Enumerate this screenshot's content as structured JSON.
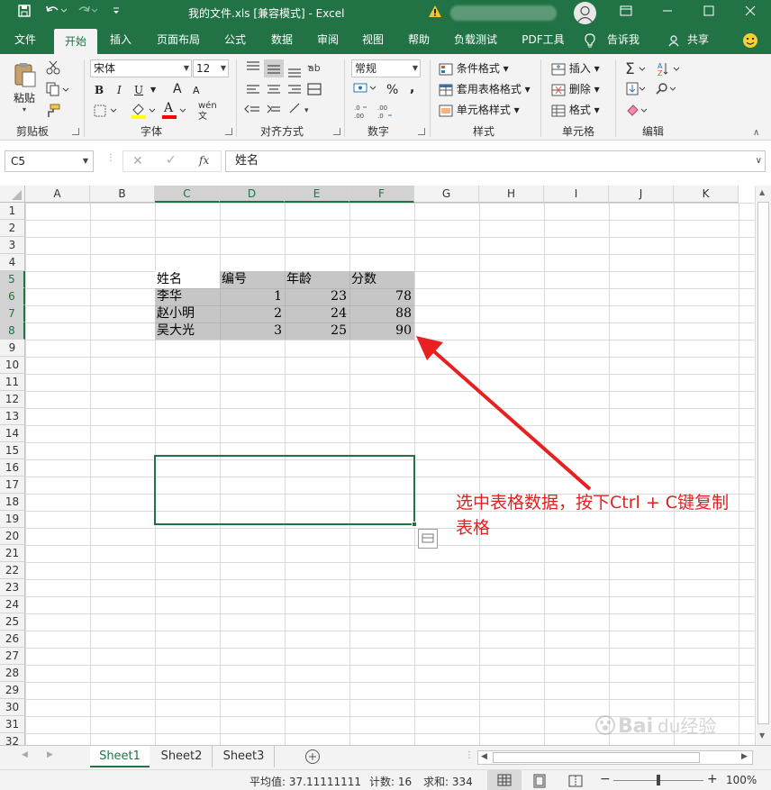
{
  "title_bar": {
    "doc_title": "我的文件.xls  [兼容模式]  -  Excel",
    "account_name": "",
    "save_icon": "save-icon",
    "undo_icon": "undo-icon",
    "redo_icon": "redo-icon",
    "warning_icon": "warning-icon",
    "accent": "#217346"
  },
  "menu_tabs": [
    "文件",
    "开始",
    "插入",
    "页面布局",
    "公式",
    "数据",
    "审阅",
    "视图",
    "帮助",
    "负载测试",
    "PDF工具"
  ],
  "menu_extra": {
    "tell_me": "告诉我",
    "share": "共享"
  },
  "ribbon": {
    "clipboard": {
      "paste": "粘贴",
      "label": "剪贴板"
    },
    "font": {
      "name": "宋体",
      "size": "12",
      "bold": "B",
      "italic": "I",
      "underline": "U",
      "grow": "A",
      "shrink": "A",
      "font_color_letter": "A",
      "phonetic": "wén",
      "label": "字体"
    },
    "alignment": {
      "label": "对齐方式"
    },
    "number": {
      "format": "常规",
      "percent": "%",
      "comma": ",",
      "label": "数字"
    },
    "styles": {
      "conditional": "条件格式",
      "table": "套用表格格式",
      "cell": "单元格样式",
      "label": "样式"
    },
    "cells": {
      "insert": "插入",
      "delete": "删除",
      "format": "格式",
      "label": "单元格"
    },
    "editing": {
      "label": "编辑"
    }
  },
  "formula_bar": {
    "name_box": "C5",
    "fx": "fx",
    "content": "姓名"
  },
  "columns": [
    "A",
    "B",
    "C",
    "D",
    "E",
    "F",
    "G",
    "H",
    "I",
    "J",
    "K"
  ],
  "selected_columns": [
    "C",
    "D",
    "E",
    "F"
  ],
  "rows": [
    "1",
    "2",
    "3",
    "4",
    "5",
    "6",
    "7",
    "8",
    "9",
    "10",
    "11",
    "12",
    "13",
    "14",
    "15",
    "16",
    "17",
    "18",
    "19",
    "20",
    "21",
    "22",
    "23",
    "24",
    "25",
    "26",
    "27",
    "28",
    "29",
    "30",
    "31",
    "32"
  ],
  "selected_rows": [
    "5",
    "6",
    "7",
    "8"
  ],
  "table": {
    "headers": [
      "姓名",
      "编号",
      "年龄",
      "分数"
    ],
    "rows": [
      [
        "李华",
        "1",
        "23",
        "78"
      ],
      [
        "赵小明",
        "2",
        "24",
        "88"
      ],
      [
        "吴大光",
        "3",
        "25",
        "90"
      ]
    ]
  },
  "annotation": "选中表格数据，按下Ctrl + C键复制表格",
  "sheets": [
    "Sheet1",
    "Sheet2",
    "Sheet3"
  ],
  "status": {
    "average": "平均值: 37.11111111",
    "count": "计数: 16",
    "sum": "求和: 334",
    "zoom": "100%"
  },
  "watermark": "Baidu经验 jingyan.baidu.com"
}
